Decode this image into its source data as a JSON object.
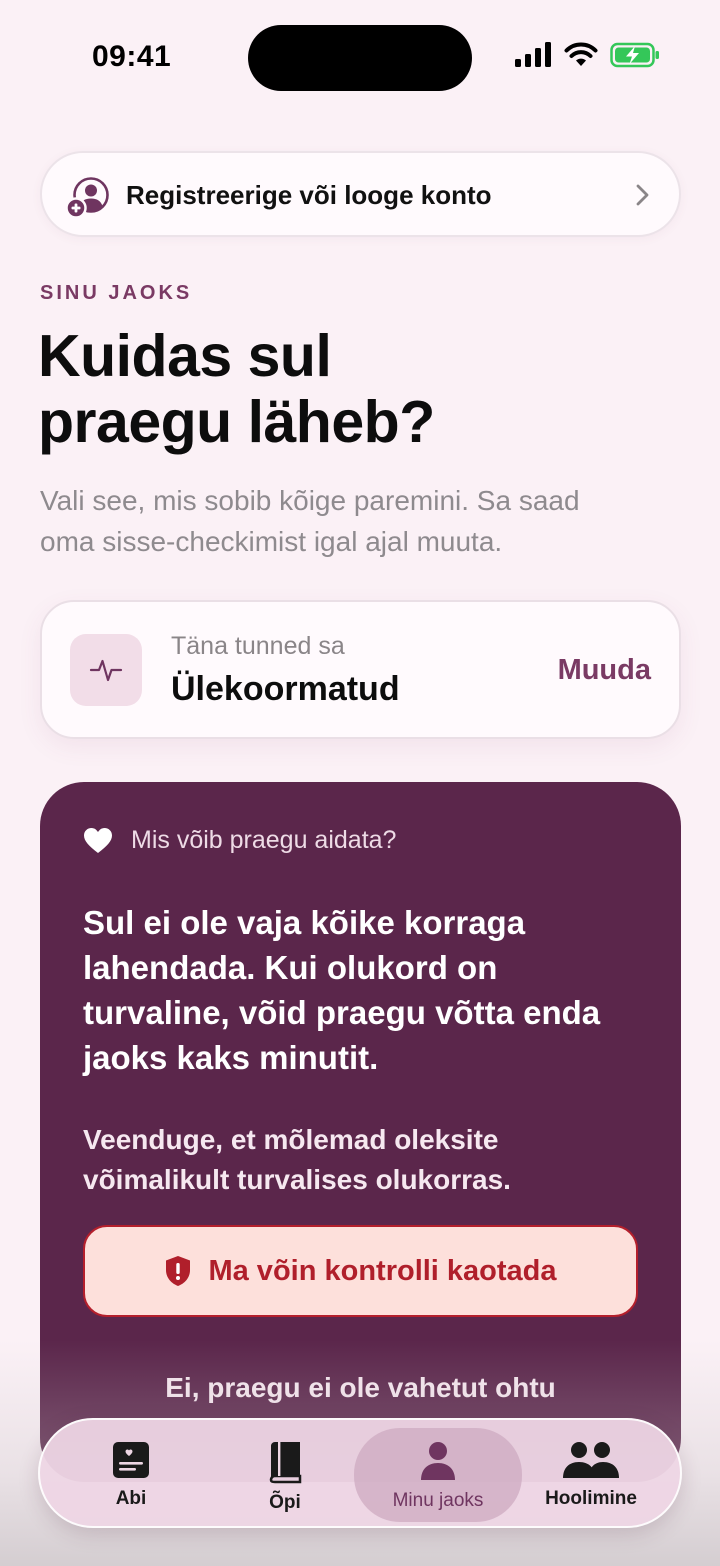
{
  "status_bar": {
    "time": "09:41"
  },
  "account_banner": {
    "label": "Registreerige või looge konto"
  },
  "section_label": "SINU JAOKS",
  "headline": {
    "line1": "Kuidas sul",
    "line2": "praegu läheb?"
  },
  "subtitle": {
    "line1": "Vali see, mis sobib kõige paremini. Sa saad",
    "line2": "oma sisse-checkimist igal ajal muuta."
  },
  "checkin": {
    "caption": "Täna tunned sa",
    "value": "Ülekoormatud",
    "change_label": "Muuda"
  },
  "help_card": {
    "header": "Mis võib praegu aidata?",
    "main_lines": [
      "Sul ei ole vaja kõike korraga",
      "lahendada. Kui olukord on",
      "turvaline, võid praegu võtta enda",
      "jaoks kaks minutit."
    ],
    "secondary_lines": [
      "Veenduge, et mõlemad oleksite",
      "võimalikult turvalises olukorras."
    ],
    "danger_button": "Ma võin kontrolli kaotada",
    "safe_link": "Ei, praegu ei ole vahetut ohtu"
  },
  "tabs": [
    {
      "label": "Abi",
      "icon": "journal-icon"
    },
    {
      "label": "Õpi",
      "icon": "book-icon"
    },
    {
      "label": "Minu jaoks",
      "icon": "person-icon",
      "active": true
    },
    {
      "label": "Hoolimine",
      "icon": "people-icon"
    }
  ],
  "colors": {
    "background": "#fbf1f6",
    "accent": "#7a3a64",
    "card_dark": "#5b264b",
    "danger": "#b01f2b",
    "danger_bg": "#fde0db",
    "battery": "#34c759"
  }
}
